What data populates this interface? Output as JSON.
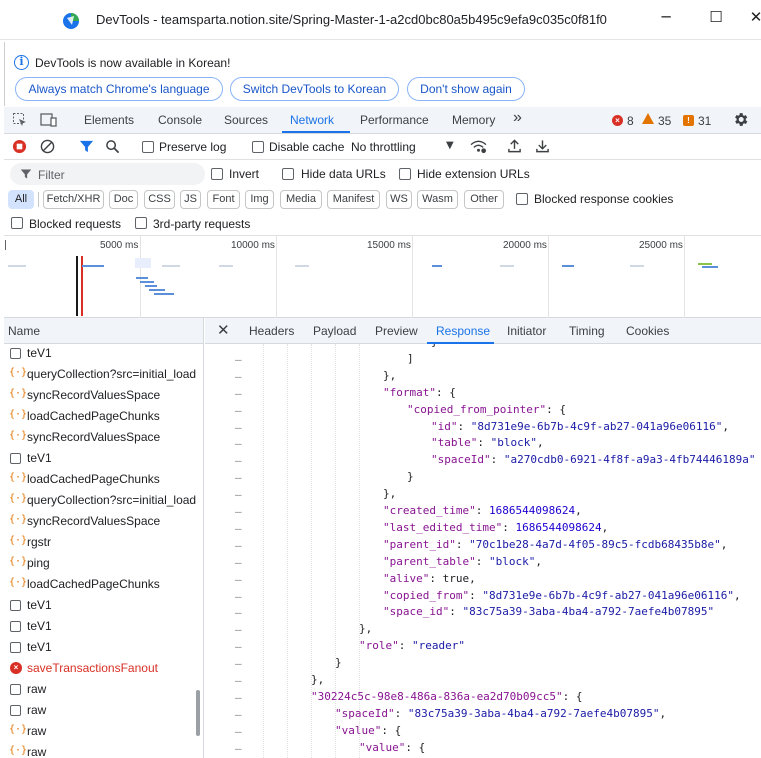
{
  "window": {
    "title": "DevTools - teamsparta.notion.site/Spring-Master-1-a2cd0bc80a5b495c9efa9c035c0f81f0",
    "minimize": "─",
    "maximize": "☐",
    "close": "✕"
  },
  "infobar": {
    "message": "DevTools is now available in Korean!",
    "buttons": [
      "Always match Chrome's language",
      "Switch DevTools to Korean",
      "Don't show again"
    ]
  },
  "tabs": {
    "items": [
      "Elements",
      "Console",
      "Sources",
      "Network",
      "Performance",
      "Memory"
    ],
    "more": "»",
    "active": "Network",
    "errors": "8",
    "warnings": "35",
    "messages": "31"
  },
  "toolbar": {
    "preserve_log": "Preserve log",
    "disable_cache": "Disable cache",
    "throttling": "No throttling"
  },
  "filter": {
    "placeholder": "Filter",
    "invert": "Invert",
    "hide_data_urls": "Hide data URLs",
    "hide_extension_urls": "Hide extension URLs"
  },
  "type_filters": [
    "All",
    "Fetch/XHR",
    "Doc",
    "CSS",
    "JS",
    "Font",
    "Img",
    "Media",
    "Manifest",
    "WS",
    "Wasm",
    "Other"
  ],
  "blocked_response_cookies": "Blocked response cookies",
  "blocked_requests": "Blocked requests",
  "third_party_requests": "3rd-party requests",
  "timeline": {
    "ticks": [
      "5000 ms",
      "10000 ms",
      "15000 ms",
      "20000 ms",
      "25000 ms"
    ]
  },
  "requests": {
    "header": "Name",
    "items": [
      {
        "name": "teV1",
        "type": "doc"
      },
      {
        "name": "queryCollection?src=initial_load",
        "type": "json"
      },
      {
        "name": "syncRecordValuesSpace",
        "type": "json"
      },
      {
        "name": "loadCachedPageChunks",
        "type": "json"
      },
      {
        "name": "syncRecordValuesSpace",
        "type": "json"
      },
      {
        "name": "teV1",
        "type": "doc"
      },
      {
        "name": "loadCachedPageChunks",
        "type": "json"
      },
      {
        "name": "queryCollection?src=initial_load",
        "type": "json"
      },
      {
        "name": "syncRecordValuesSpace",
        "type": "json"
      },
      {
        "name": "rgstr",
        "type": "json"
      },
      {
        "name": "ping",
        "type": "json"
      },
      {
        "name": "loadCachedPageChunks",
        "type": "json"
      },
      {
        "name": "teV1",
        "type": "doc"
      },
      {
        "name": "teV1",
        "type": "doc"
      },
      {
        "name": "teV1",
        "type": "doc"
      },
      {
        "name": "saveTransactionsFanout",
        "type": "error"
      },
      {
        "name": "raw",
        "type": "doc"
      },
      {
        "name": "raw",
        "type": "doc"
      },
      {
        "name": "raw",
        "type": "json"
      },
      {
        "name": "raw",
        "type": "json"
      }
    ]
  },
  "detail": {
    "close": "✕",
    "tabs": [
      "Headers",
      "Payload",
      "Preview",
      "Response",
      "Initiator",
      "Timing",
      "Cookies"
    ],
    "active": "Response"
  },
  "response": {
    "lines": [
      "}",
      "]",
      "},",
      "\"format\": {",
      "\"copied_from_pointer\": {",
      "\"id\": \"8d731e9e-6b7b-4c9f-ab27-041a96e06116\",",
      "\"table\": \"block\",",
      "\"spaceId\": \"a270cdb0-6921-4f8f-a9a3-4fb74446189a\"",
      "}",
      "},",
      "\"created_time\": 1686544098624,",
      "\"last_edited_time\": 1686544098624,",
      "\"parent_id\": \"70c1be28-4a7d-4f05-89c5-fcdb68435b8e\",",
      "\"parent_table\": \"block\",",
      "\"alive\": true,",
      "\"copied_from\": \"8d731e9e-6b7b-4c9f-ab27-041a96e06116\",",
      "\"space_id\": \"83c75a39-3aba-4ba4-a792-7aefe4b07895\"",
      "},",
      "\"role\": \"reader\"",
      "}",
      "},",
      "\"30224c5c-98e8-486a-836a-ea2d70b09cc5\": {",
      "\"spaceId\": \"83c75a39-3aba-4ba4-a792-7aefe4b07895\",",
      "\"value\": {",
      "\"value\": {"
    ],
    "gutter_mark": "–"
  },
  "colors": {
    "accent": "#1a73e8",
    "error": "#d93025",
    "warning": "#e37400",
    "json_key": "#881391",
    "json_string": "#1a1aa6",
    "json_number": "#1c00cf"
  }
}
